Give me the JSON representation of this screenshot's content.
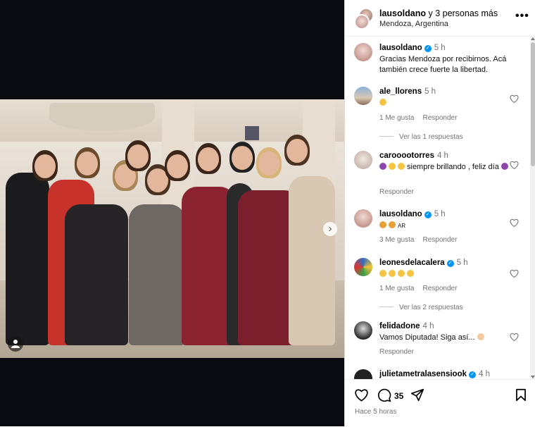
{
  "header": {
    "username": "lausoldano",
    "others": "y 3 personas más",
    "location": "Mendoza, Argentina",
    "more": "•••"
  },
  "media": {
    "next": "›"
  },
  "comments": [
    {
      "user": "lausoldano",
      "time": "5 h",
      "verified": true,
      "text": "Gracias Mendoza por recibirnos. Acá también crece fuerte la libertad."
    },
    {
      "user": "ale_llorens",
      "time": "5 h",
      "verified": false,
      "likes": "1 Me gusta",
      "reply": "Responder",
      "view_replies": "Ver las 1 respuestas"
    },
    {
      "user": "carooootorres",
      "time": "4 h",
      "verified": false,
      "text": "siempre brillando , feliz día",
      "reply": "Responder"
    },
    {
      "user": "lausoldano",
      "time": "5 h",
      "verified": true,
      "text": "AR",
      "likes": "3 Me gusta",
      "reply": "Responder"
    },
    {
      "user": "leonesdelacalera",
      "time": "5 h",
      "verified": true,
      "likes": "1 Me gusta",
      "reply": "Responder",
      "view_replies": "Ver las 2 respuestas"
    },
    {
      "user": "felidadone",
      "time": "4 h",
      "verified": false,
      "text": "Vamos Diputada! Siga así...",
      "reply": "Responder"
    },
    {
      "user": "julietametralasensiook",
      "time": "4 h",
      "verified": true
    }
  ],
  "actions": {
    "comment_count": "35",
    "posted": "Hace 5 horas"
  },
  "colors": {
    "link_blue": "#0095f6",
    "muted": "#737373",
    "border": "#dbdbdb"
  }
}
